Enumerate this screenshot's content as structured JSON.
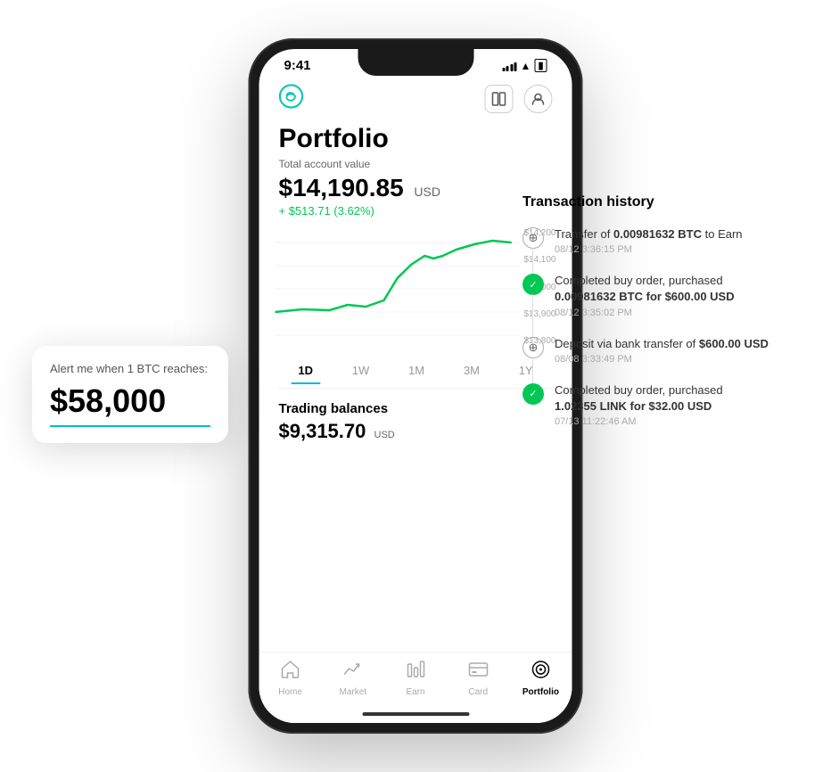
{
  "status_bar": {
    "time": "9:41"
  },
  "header": {
    "logo_label": "coinbase-logo",
    "icons": [
      "layout-icon",
      "profile-icon"
    ]
  },
  "portfolio": {
    "title": "Portfolio",
    "account_label": "Total account value",
    "account_value": "$14,190.85",
    "currency": "USD",
    "change": "+ $513.71 (3.62%)"
  },
  "chart": {
    "y_labels": [
      "$14,200",
      "$14,100",
      "$14,000",
      "$13,900",
      "$13,800"
    ]
  },
  "time_filters": {
    "options": [
      "1D",
      "1W",
      "1M",
      "3M",
      "1Y"
    ],
    "active": "1D"
  },
  "trading": {
    "title": "Trading balances",
    "value": "$9,315.70",
    "currency": "USD"
  },
  "bottom_nav": {
    "items": [
      {
        "label": "Home",
        "icon": "home-icon",
        "active": false
      },
      {
        "label": "Market",
        "icon": "market-icon",
        "active": false
      },
      {
        "label": "Earn",
        "icon": "earn-icon",
        "active": false
      },
      {
        "label": "Card",
        "icon": "card-icon",
        "active": false
      },
      {
        "label": "Portfolio",
        "icon": "portfolio-icon",
        "active": true
      }
    ]
  },
  "alert_card": {
    "label": "Alert me when 1 BTC reaches:",
    "value": "$58,000"
  },
  "transaction_history": {
    "title": "Transaction history",
    "items": [
      {
        "type": "transfer",
        "icon_type": "circle-plus",
        "text_parts": [
          "Transfer of ",
          "0.00981632 BTC",
          " to Earn"
        ],
        "date": "08/12 3:36:15 PM"
      },
      {
        "type": "buy",
        "icon_type": "check",
        "text_parts": [
          "Completed buy order, purchased ",
          "0.00981632 BTC",
          " for ",
          "$600.00 USD"
        ],
        "date": "08/12 3:35:02 PM"
      },
      {
        "type": "deposit",
        "icon_type": "circle-plus",
        "text_parts": [
          "Deposit via bank transfer of ",
          "$600.00 USD"
        ],
        "date": "08/08 3:33:49 PM"
      },
      {
        "type": "buy",
        "icon_type": "check",
        "text_parts": [
          "Completed buy order, purchased ",
          "1.02355 LINK",
          " for ",
          "$32.00 USD"
        ],
        "date": "07/13 11:22:46 AM"
      }
    ]
  }
}
